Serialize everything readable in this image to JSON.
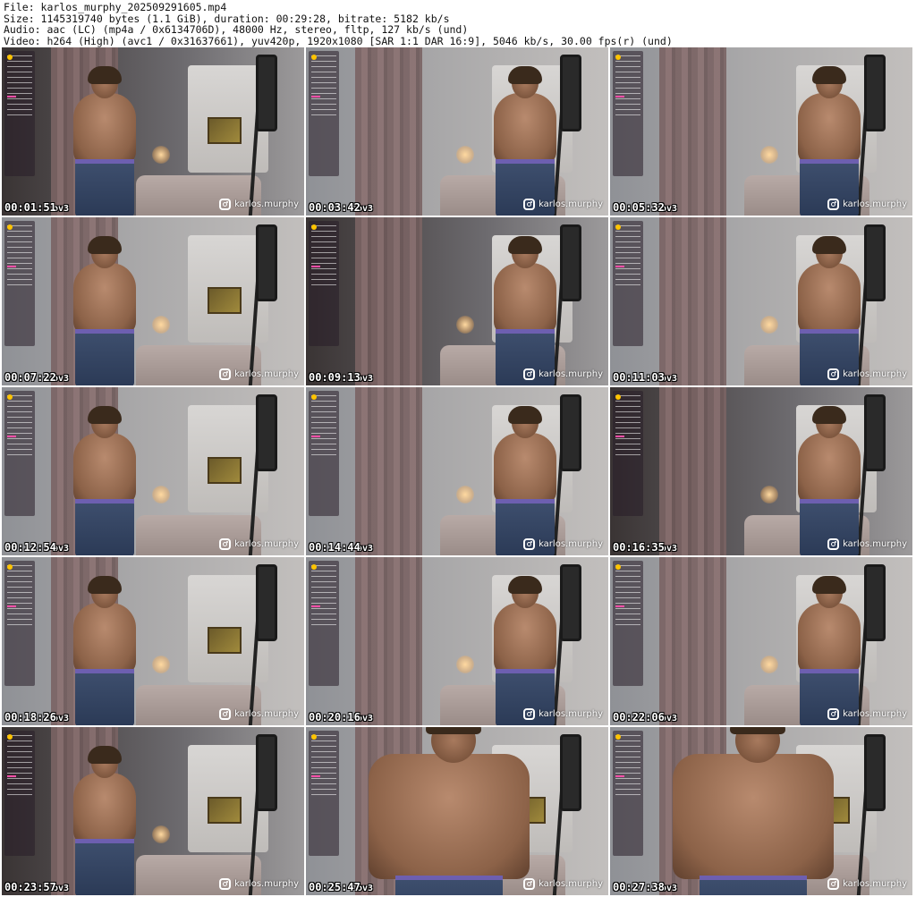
{
  "header": {
    "file_line": "File: karlos_murphy_202509291605.mp4",
    "size_line": "Size: 1145319740 bytes (1.1 GiB), duration: 00:29:28, bitrate: 5182 kb/s",
    "audio_line": "Audio: aac (LC) (mp4a / 0x6134706D), 48000 Hz, stereo, fltp, 127 kb/s (und)",
    "video_line": "Video: h264 (High) (avc1 / 0x31637661), yuv420p, 1920x1080 [SAR 1:1 DAR 16:9], 5046 kb/s, 30.00 fps(r) (und)"
  },
  "watermark": "karlos.murphy",
  "timestamp_suffix": "ov3",
  "thumbnails": [
    {
      "timestamp": "00:01:51",
      "variant": "v-dark v-left"
    },
    {
      "timestamp": "00:03:42",
      "variant": "v-right"
    },
    {
      "timestamp": "00:05:32",
      "variant": "v-right"
    },
    {
      "timestamp": "00:07:22",
      "variant": "v-left"
    },
    {
      "timestamp": "00:09:13",
      "variant": "v-dark v-right"
    },
    {
      "timestamp": "00:11:03",
      "variant": "v-right"
    },
    {
      "timestamp": "00:12:54",
      "variant": "v-left"
    },
    {
      "timestamp": "00:14:44",
      "variant": "v-right"
    },
    {
      "timestamp": "00:16:35",
      "variant": "v-dark v-right"
    },
    {
      "timestamp": "00:18:26",
      "variant": "v-left"
    },
    {
      "timestamp": "00:20:16",
      "variant": "v-right"
    },
    {
      "timestamp": "00:22:06",
      "variant": "v-right"
    },
    {
      "timestamp": "00:23:57",
      "variant": "v-dark v-left"
    },
    {
      "timestamp": "00:25:47",
      "variant": "v-close"
    },
    {
      "timestamp": "00:27:38",
      "variant": "v-close"
    }
  ]
}
